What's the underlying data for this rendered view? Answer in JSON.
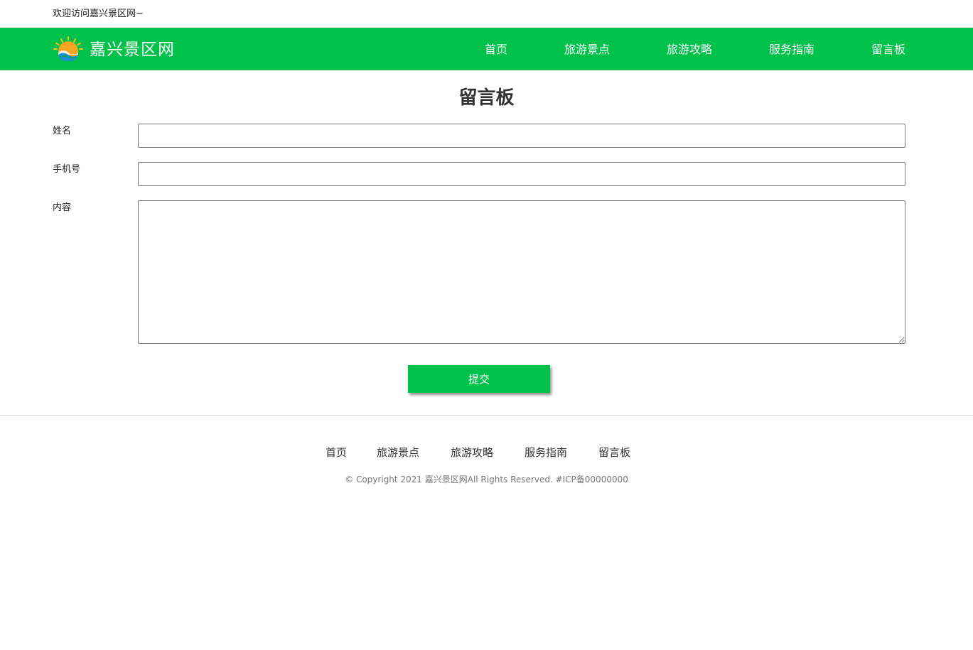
{
  "topbar": {
    "welcome": "欢迎访问嘉兴景区网~"
  },
  "header": {
    "logo_text": "嘉兴景区网",
    "logo_icon": "sun-over-waves-icon",
    "nav": [
      {
        "label": "首页"
      },
      {
        "label": "旅游景点"
      },
      {
        "label": "旅游攻略"
      },
      {
        "label": "服务指南"
      },
      {
        "label": "留言板"
      }
    ]
  },
  "main": {
    "title": "留言板",
    "form": {
      "name_label": "姓名",
      "name_value": "",
      "phone_label": "手机号",
      "phone_value": "",
      "content_label": "内容",
      "content_value": "",
      "submit_label": "提交"
    }
  },
  "footer": {
    "nav": [
      {
        "label": "首页"
      },
      {
        "label": "旅游景点"
      },
      {
        "label": "旅游攻略"
      },
      {
        "label": "服务指南"
      },
      {
        "label": "留言板"
      }
    ],
    "copyright": "© Copyright 2021 嘉兴景区网All Rights Reserved. #ICP备00000000"
  },
  "colors": {
    "brand_green": "#00c149",
    "button_green": "#00c149"
  }
}
